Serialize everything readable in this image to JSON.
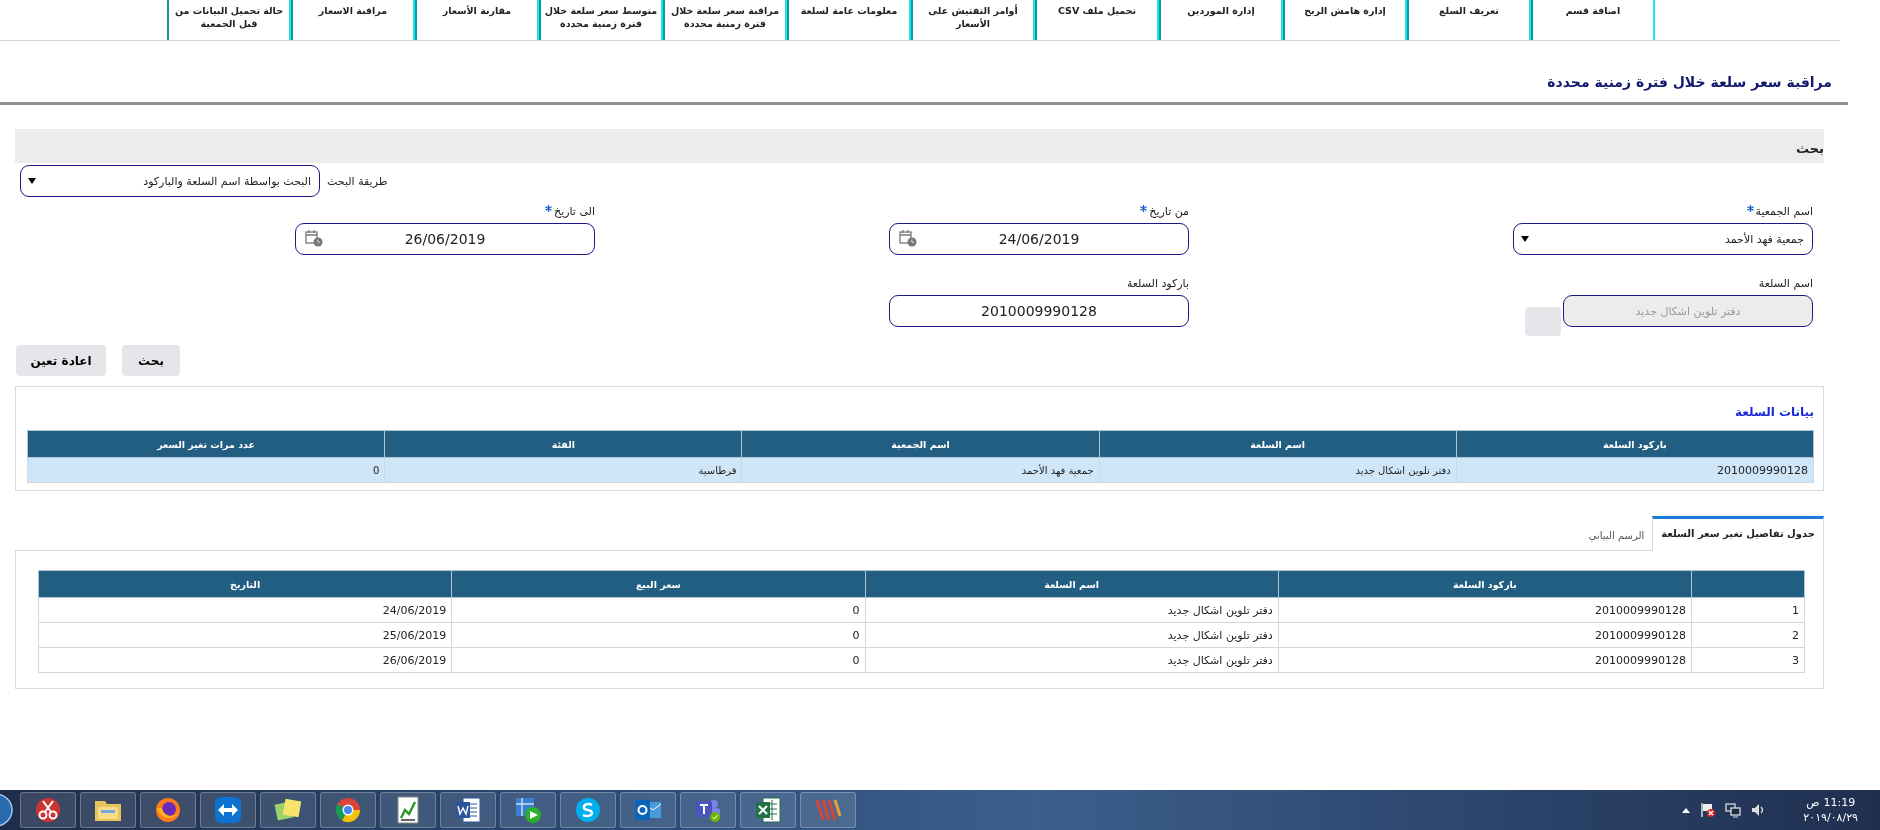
{
  "nav": {
    "tabs": [
      {
        "label": "اضافة قسم"
      },
      {
        "label": "تعريف السلع"
      },
      {
        "label": "إدارة هامش الربح"
      },
      {
        "label": "إدارة الموردين"
      },
      {
        "label": "تحميل ملف CSV"
      },
      {
        "label": "أوامر التفتيش على الأسعار"
      },
      {
        "label": "معلومات عامة لسلعة"
      },
      {
        "label": "مراقبة سعر سلعة خلال فترة زمنية محددة"
      },
      {
        "label": "متوسط سعر سلعة خلال فترة زمنية محددة"
      },
      {
        "label": "مقارنة الأسعار"
      },
      {
        "label": "مراقبة الاسعار"
      },
      {
        "label": "حالة تحميل البيانات من قبل الجمعية"
      }
    ]
  },
  "page_title": "مراقبة سعر سلعة خلال فترة زمنية محددة",
  "search": {
    "title": "بحث",
    "method": {
      "label": "طريقة البحث",
      "value": "البحث بواسطة اسم السلعة والباركود"
    },
    "rows": [
      [
        {
          "kind": "select",
          "label": "اسم الجمعية",
          "required": true,
          "disabled": false,
          "value": "جمعية فهد الأحمد"
        },
        {
          "kind": "date",
          "label": "من تاريخ",
          "required": true,
          "disabled": false,
          "value": "24/06/2019"
        },
        {
          "kind": "date",
          "label": "الى تاريخ",
          "required": true,
          "disabled": false,
          "value": "26/06/2019"
        }
      ],
      [
        {
          "kind": "lookup",
          "label": "اسم السلعة",
          "required": false,
          "disabled": true,
          "value": "دفتر تلوين اشكال جديد"
        },
        {
          "kind": "text",
          "label": "باركود السلعة",
          "required": false,
          "disabled": false,
          "value": "2010009990128"
        }
      ]
    ],
    "buttons": [
      "بحث",
      "اعادة تعين"
    ]
  },
  "item_data": {
    "title": "بيانات السلعة",
    "columns": [
      "باركود السلعة",
      "اسم السلعة",
      "اسم الجمعية",
      "الفئة",
      "عدد مرات تغير السعر"
    ],
    "rows": [
      [
        "2010009990128",
        "دفتر تلوين اشكال جديد",
        "جمعية فهد الأحمد",
        "قرطاسية",
        "0"
      ]
    ]
  },
  "tabs": [
    {
      "label": "جدول تفاصيل تغير سعر السلعة",
      "selected": true
    },
    {
      "label": "الرسم البياني",
      "selected": false
    }
  ],
  "details_table": {
    "columns": [
      "باركود السلعة",
      "اسم السلعة",
      "سعر البيع",
      "التاريخ"
    ],
    "rows": [
      {
        "index": "1",
        "cells": [
          "2010009990128",
          "دفتر تلوين اشكال جديد",
          "0",
          "24/06/2019"
        ]
      },
      {
        "index": "2",
        "cells": [
          "2010009990128",
          "دفتر تلوين اشكال جديد",
          "0",
          "25/06/2019"
        ]
      },
      {
        "index": "3",
        "cells": [
          "2010009990128",
          "دفتر تلوين اشكال جديد",
          "0",
          "26/06/2019"
        ]
      }
    ]
  },
  "taskbar": {
    "time": "11:19",
    "period": "ص",
    "date": "٢٠١٩/٠٨/٢٩"
  }
}
